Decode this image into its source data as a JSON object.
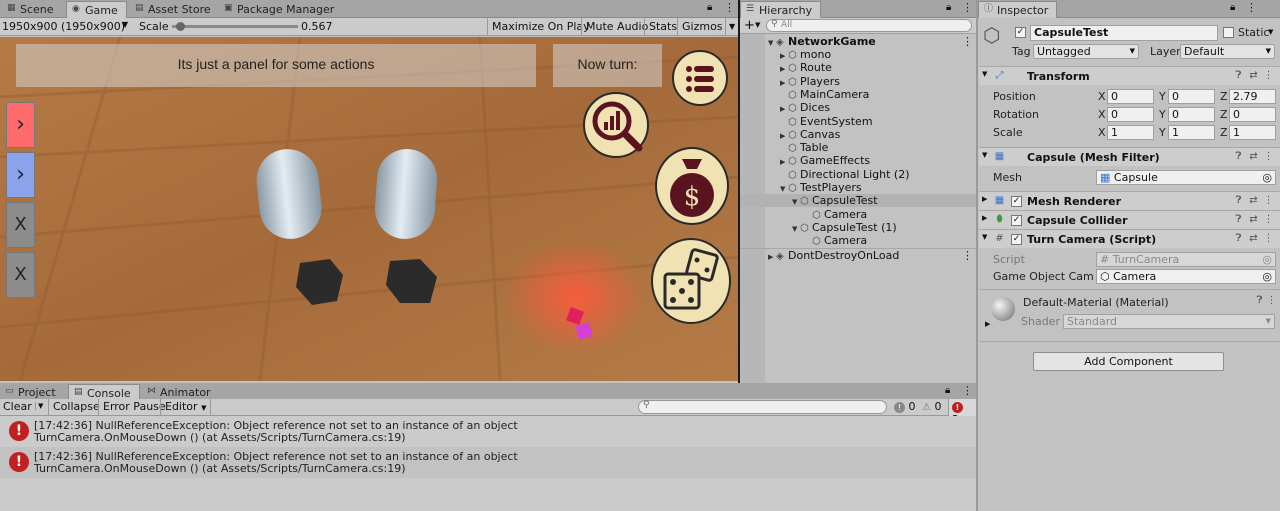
{
  "tabs_left": [
    {
      "label": "Scene",
      "icon": "grid-icon"
    },
    {
      "label": "Game",
      "icon": "gamepad-icon"
    },
    {
      "label": "Asset Store",
      "icon": "bag-icon"
    },
    {
      "label": "Package Manager",
      "icon": "package-icon"
    }
  ],
  "game_toolbar": {
    "resolution": "1950x900 (1950x900)",
    "scale_label": "Scale",
    "scale_value": "0.567",
    "scale_fraction": 0.03,
    "maximize": "Maximize On Play",
    "mute": "Mute Audio",
    "stats": "Stats",
    "gizmos": "Gizmos"
  },
  "game_view": {
    "panel_text": "Its  just a panel for some actions",
    "turn_text": "Now turn:",
    "left_buttons": [
      {
        "color": "#ff6b6b",
        "glyph": "›"
      },
      {
        "color": "#8aa3ea",
        "glyph": "›"
      },
      {
        "color": "#8c8c8c",
        "glyph": "X"
      },
      {
        "color": "#8c8c8c",
        "glyph": "X"
      }
    ],
    "wood_color": "#a9703f"
  },
  "hierarchy": {
    "title": "Hierarchy",
    "search_placeholder": "All",
    "add_label": "+",
    "root": "NetworkGame",
    "items": [
      {
        "label": "mono",
        "indent": 1,
        "arrow": "▶"
      },
      {
        "label": "Route",
        "indent": 1,
        "arrow": "▶"
      },
      {
        "label": "Players",
        "indent": 1,
        "arrow": "▶"
      },
      {
        "label": "MainCamera",
        "indent": 1,
        "arrow": ""
      },
      {
        "label": "Dices",
        "indent": 1,
        "arrow": "▶"
      },
      {
        "label": "EventSystem",
        "indent": 1,
        "arrow": ""
      },
      {
        "label": "Canvas",
        "indent": 1,
        "arrow": "▶"
      },
      {
        "label": "Table",
        "indent": 1,
        "arrow": ""
      },
      {
        "label": "GameEffects",
        "indent": 1,
        "arrow": "▶"
      },
      {
        "label": "Directional Light (2)",
        "indent": 1,
        "arrow": ""
      },
      {
        "label": "TestPlayers",
        "indent": 1,
        "arrow": "▼"
      },
      {
        "label": "CapsuleTest",
        "indent": 2,
        "arrow": "▼",
        "selected": true
      },
      {
        "label": "Camera",
        "indent": 3,
        "arrow": ""
      },
      {
        "label": "CapsuleTest (1)",
        "indent": 2,
        "arrow": "▼"
      },
      {
        "label": "Camera",
        "indent": 3,
        "arrow": ""
      }
    ],
    "dont_destroy": "DontDestroyOnLoad"
  },
  "inspector": {
    "title": "Inspector",
    "object_name": "CapsuleTest",
    "static_label": "Static",
    "tag_label": "Tag",
    "tag_value": "Untagged",
    "layer_label": "Layer",
    "layer_value": "Default",
    "transform": {
      "title": "Transform",
      "position_label": "Position",
      "rotation_label": "Rotation",
      "scale_label": "Scale",
      "position": [
        "0",
        "0",
        "2.79"
      ],
      "rotation": [
        "0",
        "0",
        "0"
      ],
      "scale": [
        "1",
        "1",
        "1"
      ],
      "axes": [
        "X",
        "Y",
        "Z"
      ]
    },
    "mesh_filter": {
      "title": "Capsule (Mesh Filter)",
      "mesh_label": "Mesh",
      "mesh_value": "Capsule"
    },
    "mesh_renderer": "Mesh Renderer",
    "capsule_collider": "Capsule Collider",
    "turn_camera": {
      "title": "Turn Camera (Script)",
      "script_label": "Script",
      "script_value": "TurnCamera",
      "cam_label": "Game Object Cam",
      "cam_value": "Camera"
    },
    "material": {
      "title": "Default-Material (Material)",
      "shader_label": "Shader",
      "shader_value": "Standard"
    },
    "add_component": "Add Component"
  },
  "bottom_tabs": [
    {
      "label": "Project",
      "icon": "folder-icon"
    },
    {
      "label": "Console",
      "icon": "console-icon"
    },
    {
      "label": "Animator",
      "icon": "animator-icon"
    }
  ],
  "console_toolbar": {
    "clear": "Clear",
    "collapse": "Collapse",
    "error_pause": "Error Pause",
    "editor": "Editor",
    "info_count": "0",
    "warn_count": "0",
    "error_count": "2"
  },
  "console_entries": [
    {
      "line1": "[17:42:36] NullReferenceException: Object reference not set to an instance of an object",
      "line2": "TurnCamera.OnMouseDown () (at Assets/Scripts/TurnCamera.cs:19)"
    },
    {
      "line1": "[17:42:36] NullReferenceException: Object reference not set to an instance of an object",
      "line2": "TurnCamera.OnMouseDown () (at Assets/Scripts/TurnCamera.cs:19)"
    }
  ],
  "colors": {
    "error": "#c21f1f",
    "panel_bg": "#c2c2c2",
    "selected_row": "#b2b2b2"
  }
}
